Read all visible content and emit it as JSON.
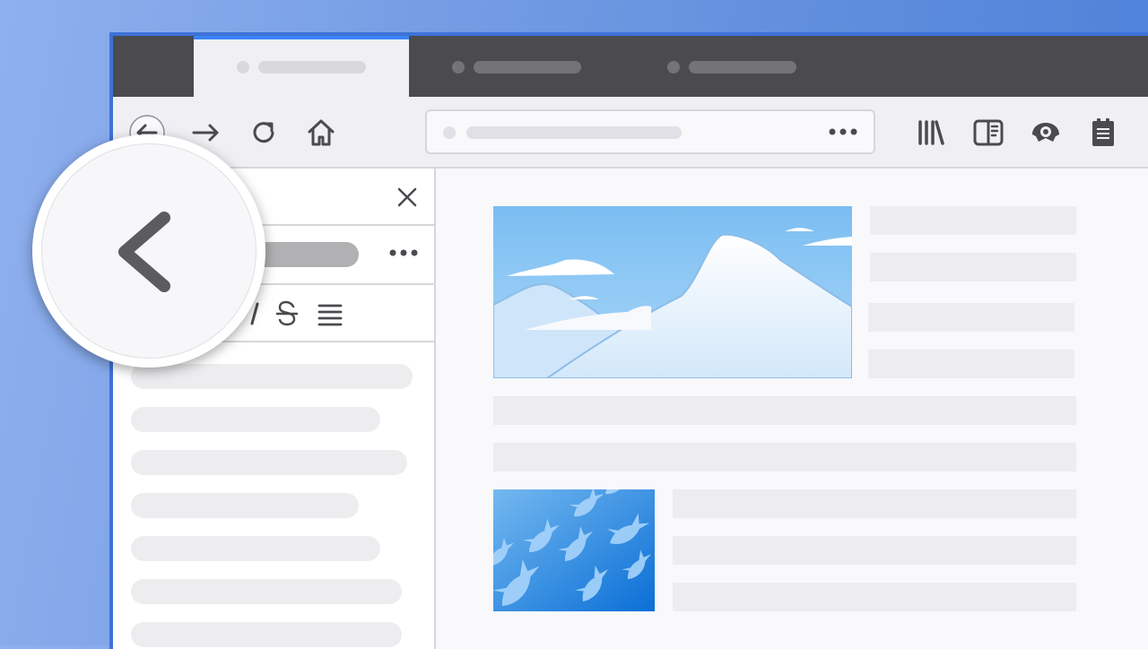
{
  "window": {
    "title": ""
  },
  "tabs": [
    {
      "state": "active"
    },
    {
      "state": "inactive"
    },
    {
      "state": "inactive"
    }
  ],
  "toolbar": {
    "icons": [
      "back-arrow-icon",
      "forward-arrow-icon",
      "reload-icon",
      "home-icon",
      "library-icon",
      "sidebar-toggle-icon",
      "screenshot-icon",
      "notes-icon"
    ]
  },
  "urlbar": {
    "more_icon": "ellipsis-icon"
  },
  "sidebar": {
    "header_close_icon": "close-icon",
    "more_icon": "ellipsis-icon",
    "format_icons": [
      "italic-icon",
      "strikethrough-icon",
      "list-icon"
    ],
    "note_lines": 7
  },
  "magnifier": {
    "icon": "chevron-left-icon"
  },
  "colors": {
    "accent": "#3b83f6",
    "chrome_dark": "#4a4a4f",
    "toolbar_bg": "#f0f0f4",
    "placeholder": "#ededf0",
    "icon": "#4a4a4f",
    "sky": "#8cc8f5"
  }
}
